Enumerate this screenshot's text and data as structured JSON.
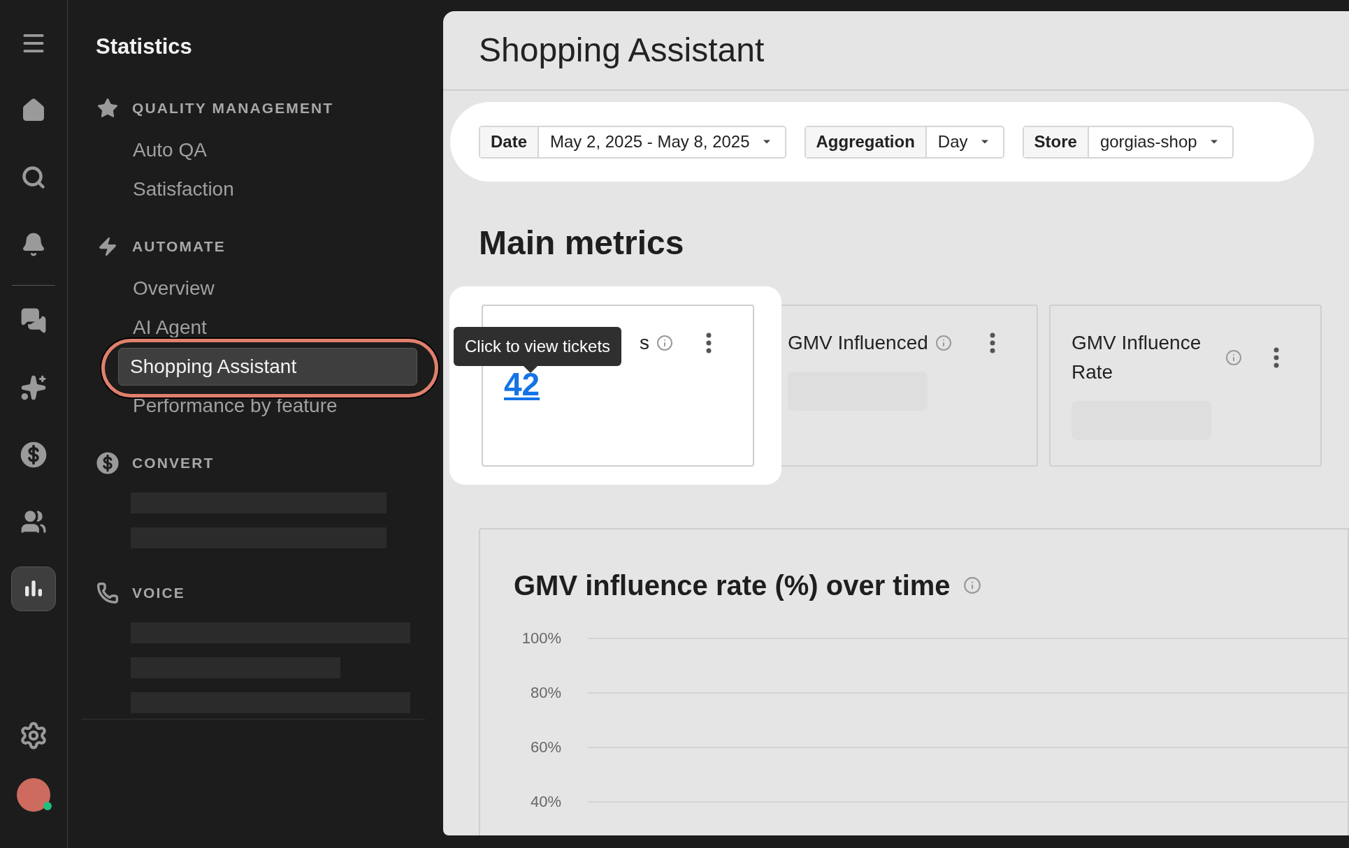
{
  "rail": {
    "items": [
      {
        "selected": false
      },
      {
        "selected": false
      },
      {
        "selected": false
      },
      {
        "selected": false
      },
      {
        "selected": false
      },
      {
        "selected": false
      },
      {
        "selected": false
      },
      {
        "selected": false
      },
      {
        "selected": true
      }
    ],
    "avatar": {
      "color": "#cd6b5f",
      "online": true
    }
  },
  "nav": {
    "title": "Statistics",
    "sections": [
      {
        "label": "QUALITY MANAGEMENT",
        "items": [
          {
            "kind": "link",
            "label": "Auto QA",
            "selected": false
          },
          {
            "kind": "link",
            "label": "Satisfaction",
            "selected": false
          }
        ]
      },
      {
        "label": "AUTOMATE",
        "items": [
          {
            "kind": "link",
            "label": "Overview",
            "selected": false
          },
          {
            "kind": "link",
            "label": "AI Agent",
            "selected": false
          },
          {
            "kind": "link",
            "label": "Shopping Assistant",
            "selected": true,
            "highlighted": true
          },
          {
            "kind": "link",
            "label": "Performance by feature",
            "selected": false
          }
        ]
      },
      {
        "label": "CONVERT",
        "items": [
          {
            "kind": "skeleton"
          },
          {
            "kind": "skeleton"
          }
        ]
      },
      {
        "label": "VOICE",
        "items": [
          {
            "kind": "skeleton"
          },
          {
            "kind": "skeleton"
          },
          {
            "kind": "skeleton"
          }
        ]
      }
    ]
  },
  "page": {
    "title": "Shopping Assistant",
    "filters": [
      {
        "label": "Date",
        "value": "May 2, 2025 - May 8, 2025"
      },
      {
        "label": "Aggregation",
        "value": "Day"
      },
      {
        "label": "Store",
        "value": "gorgias-shop"
      }
    ]
  },
  "main_metrics": {
    "heading": "Main metrics",
    "cards": [
      {
        "title": "s",
        "value": "42",
        "loading": false,
        "spotlight": true,
        "tooltip": "Click to view tickets"
      },
      {
        "title": "GMV Influenced",
        "loading": true,
        "spotlight": false
      },
      {
        "title": "GMV Influence Rate",
        "loading": true,
        "spotlight": false
      }
    ]
  },
  "chart": {
    "title": "GMV influence rate (%) over time",
    "axis_labels": [
      "100%",
      "80%",
      "60%",
      "40%"
    ]
  }
}
